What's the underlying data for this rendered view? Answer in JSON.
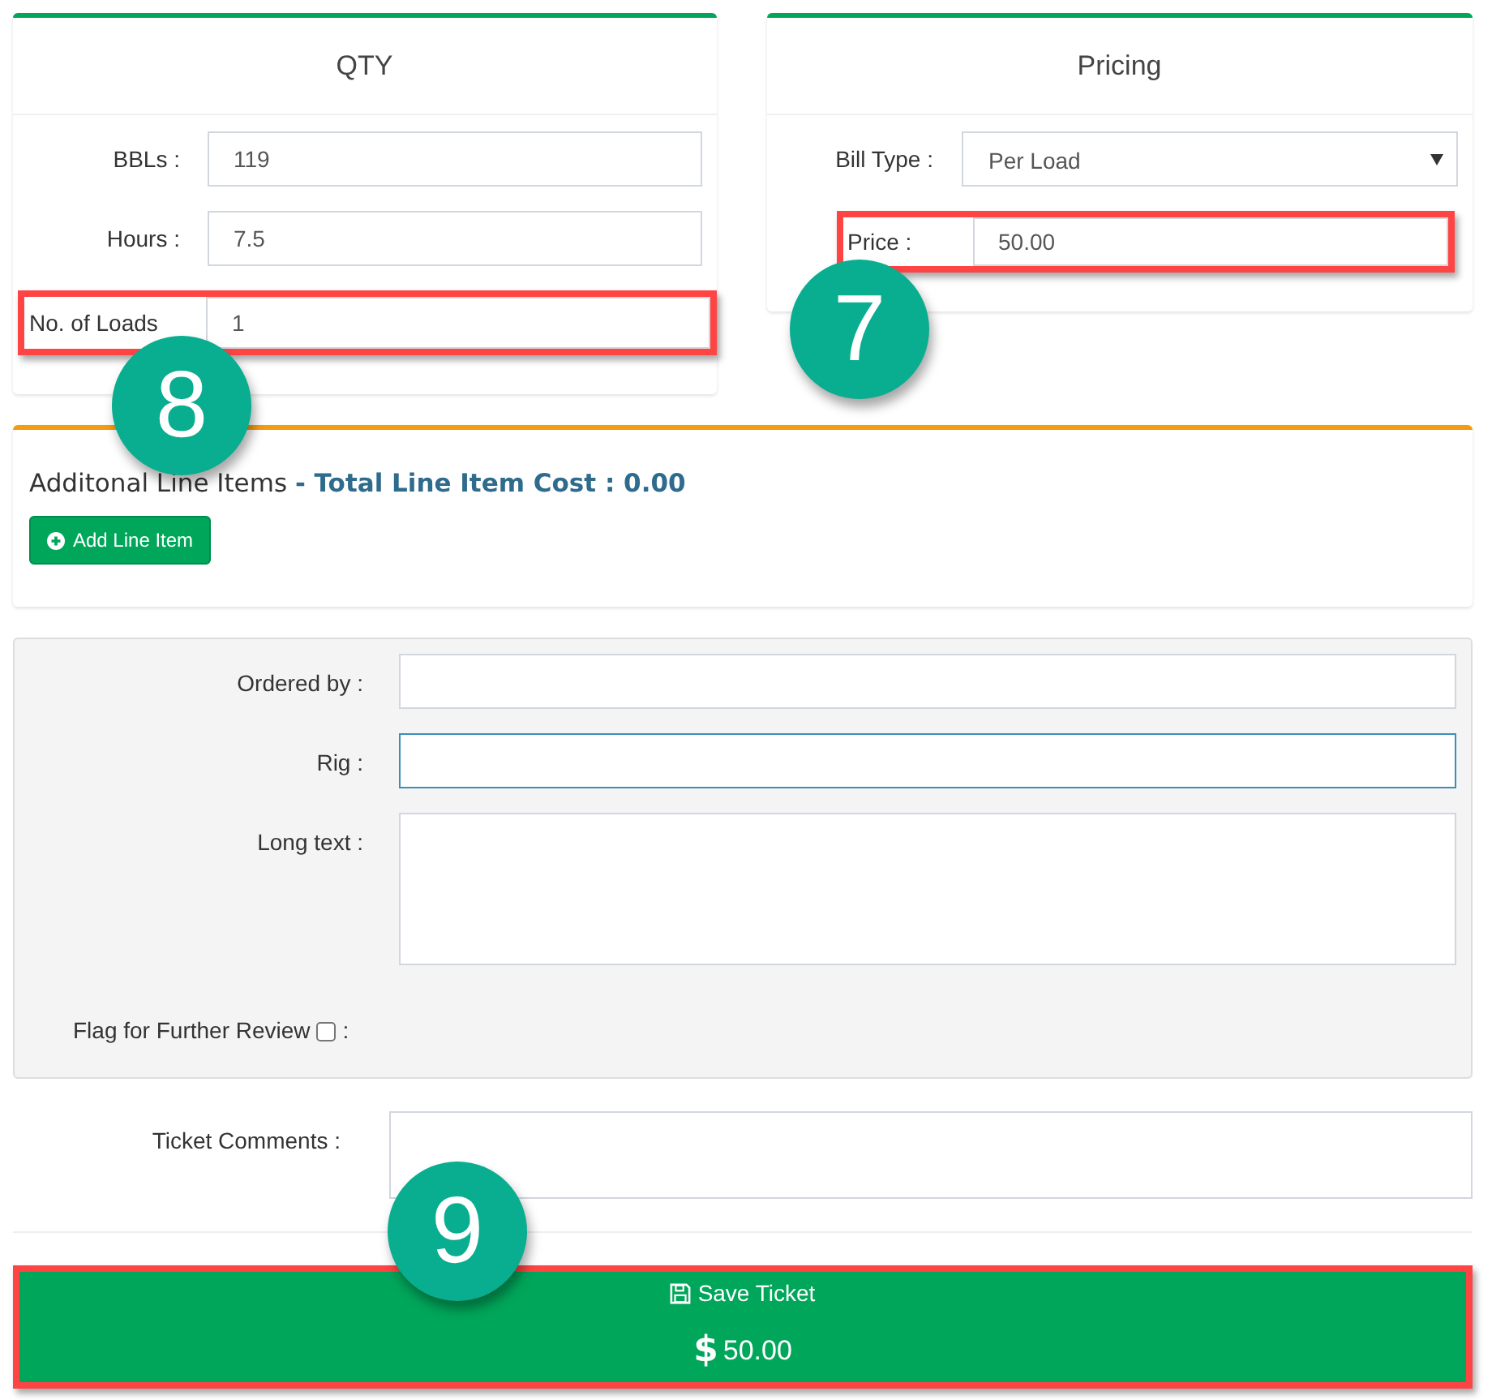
{
  "qty": {
    "title": "QTY",
    "fields": [
      {
        "label": "BBLs :",
        "value": "119",
        "highlighted": false
      },
      {
        "label": "Hours :",
        "value": "7.5",
        "highlighted": false
      },
      {
        "label": "No. of Loads",
        "value": "1",
        "highlighted": true
      }
    ]
  },
  "pricing": {
    "title": "Pricing",
    "bill_type": {
      "label": "Bill Type :",
      "value": "Per Load"
    },
    "price": {
      "label": "Price :",
      "value": "50.00",
      "highlighted": true
    }
  },
  "line_items": {
    "title": "Additonal Line Items",
    "total": "- Total Line Item Cost : 0.00",
    "button": "Add Line Item"
  },
  "details": {
    "fields": [
      {
        "kind": "input",
        "label": "Ordered by :",
        "focused": false
      },
      {
        "kind": "input",
        "label": "Rig :",
        "focused": true
      },
      {
        "kind": "textarea",
        "label": "Long text :",
        "focused": false
      }
    ],
    "flag": {
      "label": "Flag for Further Review",
      "suffix": ":",
      "checked": false
    }
  },
  "ticket_comments": {
    "label": "Ticket Comments :"
  },
  "save": {
    "label": "Save Ticket",
    "currency": "$",
    "amount": "50.00",
    "highlighted": true
  },
  "callouts": [
    {
      "number": "7"
    },
    {
      "number": "8"
    },
    {
      "number": "9"
    }
  ]
}
